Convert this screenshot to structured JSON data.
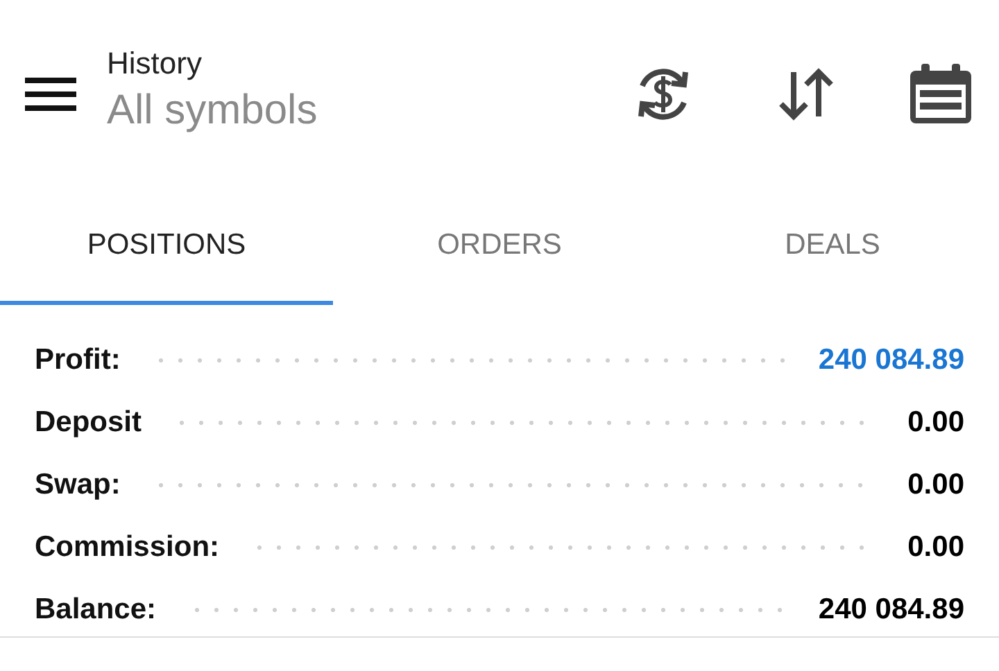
{
  "header": {
    "title": "History",
    "subtitle": "All symbols"
  },
  "tabs": [
    {
      "label": "POSITIONS",
      "selected": true
    },
    {
      "label": "ORDERS",
      "selected": false
    },
    {
      "label": "DEALS",
      "selected": false
    }
  ],
  "summary": [
    {
      "label": "Profit:",
      "value": "240 084.89",
      "color": "#1976d2"
    },
    {
      "label": "Deposit",
      "value": "0.00",
      "color": "#000000"
    },
    {
      "label": "Swap:",
      "value": "0.00",
      "color": "#000000"
    },
    {
      "label": "Commission:",
      "value": "0.00",
      "color": "#000000"
    },
    {
      "label": "Balance:",
      "value": "240 084.89",
      "color": "#000000"
    }
  ]
}
